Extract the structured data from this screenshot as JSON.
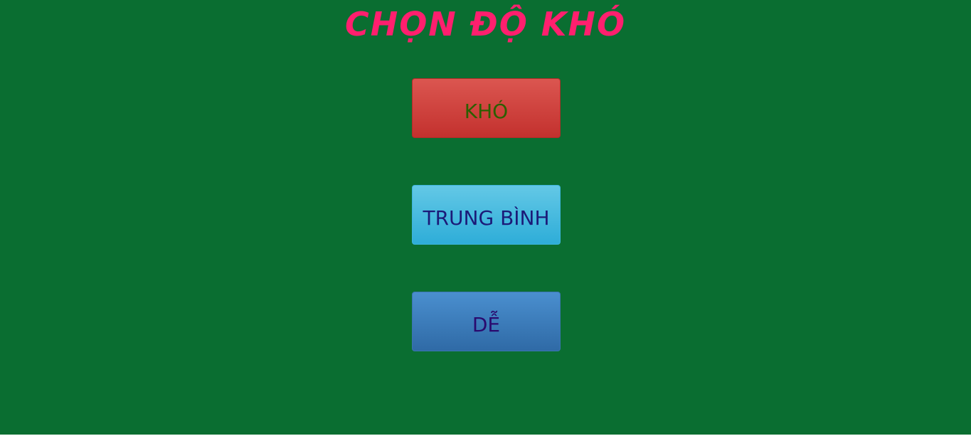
{
  "title": "CHỌN ĐỘ KHÓ",
  "buttons": {
    "hard": "KHÓ",
    "medium": "TRUNG BÌNH",
    "easy": "DỄ"
  },
  "colors": {
    "background": "#0a6e31",
    "title": "#ff1f6e",
    "hard_button": "#d04440",
    "medium_button": "#4abde0",
    "easy_button": "#3d7dbd"
  }
}
